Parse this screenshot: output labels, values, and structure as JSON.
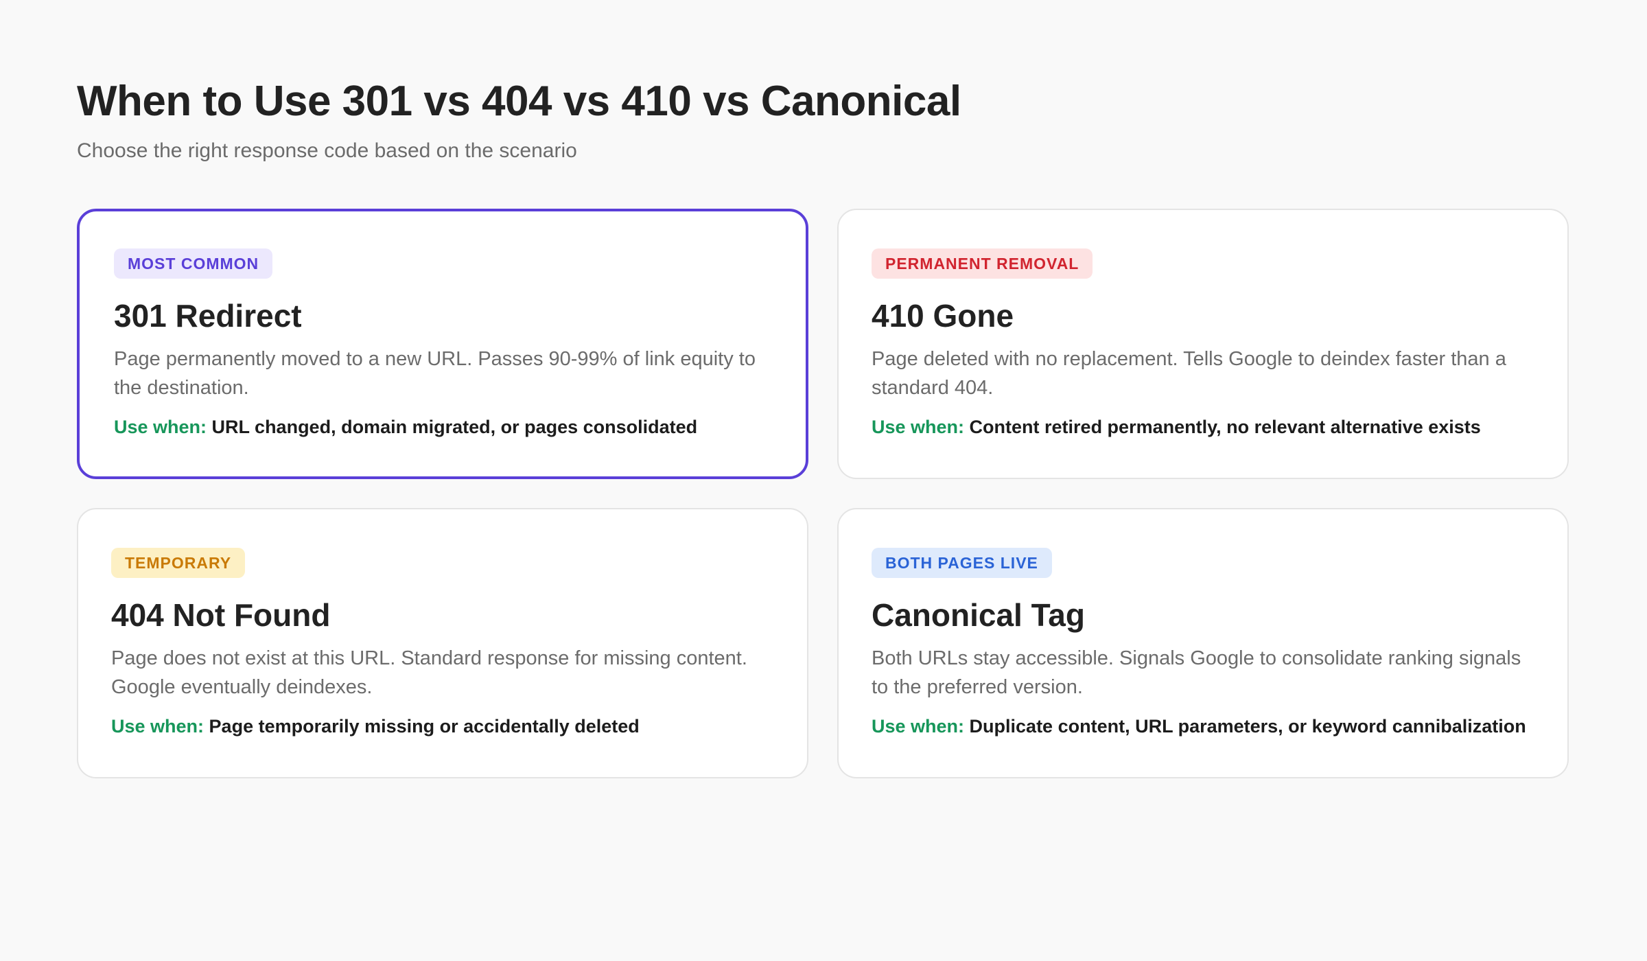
{
  "header": {
    "title": "When to Use 301 vs 404 vs 410 vs Canonical",
    "subtitle": "Choose the right response code based on the scenario"
  },
  "cards": [
    {
      "badge": "MOST COMMON",
      "badge_bg": "#ece8fd",
      "badge_color": "#5a3fd8",
      "title": "301 Redirect",
      "description": "Page permanently moved to a new URL. Passes 90-99% of link equity to the destination.",
      "use_label": "Use when:",
      "use_text": "URL changed, domain migrated, or pages consolidated",
      "highlighted": true
    },
    {
      "badge": "PERMANENT REMOVAL",
      "badge_bg": "#fde2e2",
      "badge_color": "#d1242f",
      "title": "410 Gone",
      "description": "Page deleted with no replacement. Tells Google to deindex faster than a standard 404.",
      "use_label": "Use when:",
      "use_text": "Content retired permanently, no relevant alternative exists",
      "highlighted": false
    },
    {
      "badge": "TEMPORARY",
      "badge_bg": "#fdf0c4",
      "badge_color": "#c97a06",
      "title": "404 Not Found",
      "description": "Page does not exist at this URL. Standard response for missing content. Google eventually deindexes.",
      "use_label": "Use when:",
      "use_text": "Page temporarily missing or accidentally deleted",
      "highlighted": false
    },
    {
      "badge": "BOTH PAGES LIVE",
      "badge_bg": "#deeafc",
      "badge_color": "#2a63d6",
      "title": "Canonical Tag",
      "description": "Both URLs stay accessible. Signals Google to consolidate ranking signals to the preferred version.",
      "use_label": "Use when:",
      "use_text": "Duplicate content, URL parameters, or keyword cannibalization",
      "highlighted": false
    }
  ],
  "colors": {
    "accent": "#5a3fd8",
    "use_label": "#17965a",
    "background": "#f9f9f9"
  }
}
